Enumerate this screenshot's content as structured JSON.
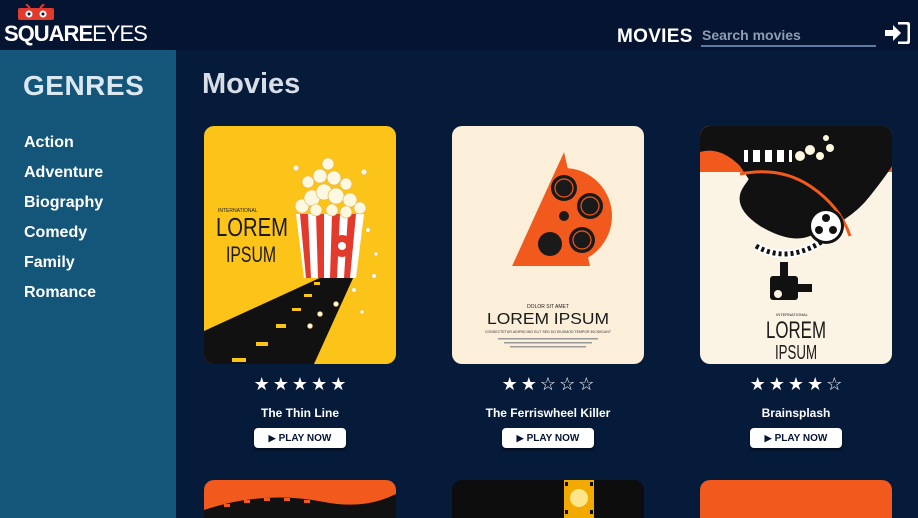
{
  "header": {
    "logo_text_bold": "SQUARE",
    "logo_text_light": "EYES",
    "nav_movies": "MOVIES",
    "search_placeholder": "Search movies"
  },
  "sidebar": {
    "title": "GENRES",
    "items": [
      "Action",
      "Adventure",
      "Biography",
      "Comedy",
      "Family",
      "Romance"
    ]
  },
  "main": {
    "title": "Movies",
    "play_label": "PLAY NOW",
    "movies": [
      {
        "title": "The Thin Line",
        "rating": 5,
        "poster_small": "INTERNATIONAL",
        "poster_line1": "LOREM",
        "poster_line2": "IPSUM"
      },
      {
        "title": "The Ferriswheel Killer",
        "rating": 2,
        "poster_small": "DOLOR SIT AMET",
        "poster_line1": "LOREM IPSUM",
        "poster_caption": "CONSECTETUR ADIPISCING ELIT SED DO EIUSMOD TEMPOR INCIDIDUNT"
      },
      {
        "title": "Brainsplash",
        "rating": 4,
        "poster_small": "INTERNATIONAL",
        "poster_line1": "LOREM",
        "poster_line2": "IPSUM"
      }
    ]
  },
  "colors": {
    "header_bg": "#041431",
    "sidebar_bg": "#135679",
    "page_bg": "#061a3a",
    "poster_yellow": "#fcc419",
    "poster_orange": "#f25a1d",
    "poster_cream": "#fbefd9"
  }
}
